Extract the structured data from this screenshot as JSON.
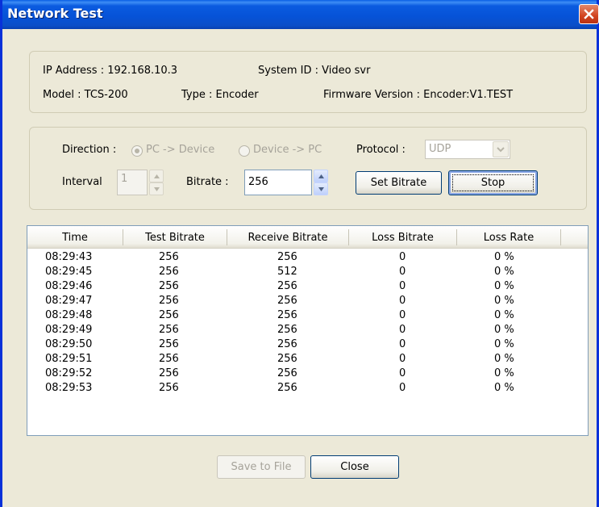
{
  "window": {
    "title": "Network Test"
  },
  "info": {
    "ip_address": "IP Address : 192.168.10.3",
    "system_id": "System ID : Video svr",
    "model": "Model : TCS-200",
    "type": "Type : Encoder",
    "firmware": "Firmware Version : Encoder:V1.TEST"
  },
  "test": {
    "direction_label": "Direction :",
    "direction_options": [
      "PC -> Device",
      "Device -> PC"
    ],
    "direction_selected": "PC -> Device",
    "protocol_label": "Protocol :",
    "protocol_value": "UDP",
    "interval_label": "Interval",
    "interval_value": "1",
    "bitrate_label": "Bitrate :",
    "bitrate_value": "256",
    "set_bitrate_label": "Set Bitrate",
    "stop_label": "Stop"
  },
  "table": {
    "columns": [
      "Time",
      "Test Bitrate",
      "Receive Bitrate",
      "Loss Bitrate",
      "Loss Rate"
    ],
    "rows": [
      [
        "08:29:43",
        "256",
        "256",
        "0",
        "0 %"
      ],
      [
        "08:29:45",
        "256",
        "512",
        "0",
        "0 %"
      ],
      [
        "08:29:46",
        "256",
        "256",
        "0",
        "0 %"
      ],
      [
        "08:29:47",
        "256",
        "256",
        "0",
        "0 %"
      ],
      [
        "08:29:48",
        "256",
        "256",
        "0",
        "0 %"
      ],
      [
        "08:29:49",
        "256",
        "256",
        "0",
        "0 %"
      ],
      [
        "08:29:50",
        "256",
        "256",
        "0",
        "0 %"
      ],
      [
        "08:29:51",
        "256",
        "256",
        "0",
        "0 %"
      ],
      [
        "08:29:52",
        "256",
        "256",
        "0",
        "0 %"
      ],
      [
        "08:29:53",
        "256",
        "256",
        "0",
        "0 %"
      ]
    ]
  },
  "footer": {
    "save_label": "Save to File",
    "close_label": "Close"
  },
  "colors": {
    "title_bar": "#0653d8",
    "dialog_bg": "#ece9d8",
    "close_button": "#d2431f"
  }
}
